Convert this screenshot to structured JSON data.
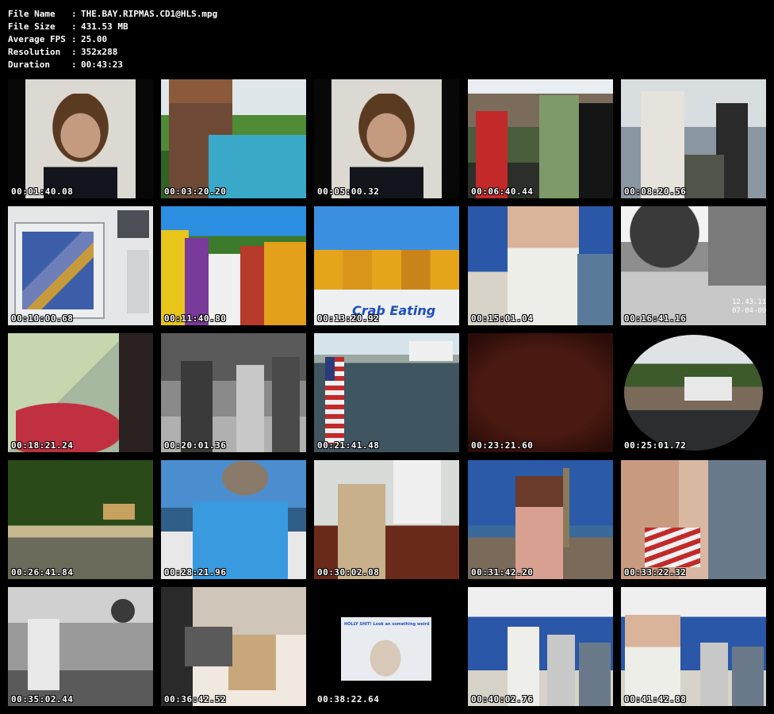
{
  "info": {
    "rows": [
      {
        "key": "File Name",
        "sep": ":",
        "value": "THE.BAY.RIPMAS.CD1@HLS.mpg"
      },
      {
        "key": "File Size",
        "sep": ":",
        "value": "431.53 MB"
      },
      {
        "key": "Average FPS",
        "sep": ":",
        "value": "25.00"
      },
      {
        "key": "Resolution",
        "sep": ":",
        "value": "352x288"
      },
      {
        "key": "Duration",
        "sep": ":",
        "value": "00:43:23"
      }
    ]
  },
  "thumbnails": [
    {
      "timestamp": "00:01:40.08"
    },
    {
      "timestamp": "00:03:20.20"
    },
    {
      "timestamp": "00:05:00.32"
    },
    {
      "timestamp": "00:06:40.44"
    },
    {
      "timestamp": "00:08:20.56"
    },
    {
      "timestamp": "00:10:00.68"
    },
    {
      "timestamp": "00:11:40.80"
    },
    {
      "timestamp": "00:13:20.92",
      "caption": "Crab Eating"
    },
    {
      "timestamp": "00:15:01.04"
    },
    {
      "timestamp": "00:16:41.16",
      "caption": "12.43.11\n07-04-09"
    },
    {
      "timestamp": "00:18:21.24"
    },
    {
      "timestamp": "00:20:01.36"
    },
    {
      "timestamp": "00:21:41.48"
    },
    {
      "timestamp": "00:23:21.60"
    },
    {
      "timestamp": "00:25:01.72"
    },
    {
      "timestamp": "00:26:41.84"
    },
    {
      "timestamp": "00:28:21.96"
    },
    {
      "timestamp": "00:30:02.08"
    },
    {
      "timestamp": "00:31:42.20"
    },
    {
      "timestamp": "00:33:22.32"
    },
    {
      "timestamp": "00:35:02.44"
    },
    {
      "timestamp": "00:36:42.52"
    },
    {
      "timestamp": "00:38:22.64",
      "caption": "HOLLY SHIT! Look an something weird"
    },
    {
      "timestamp": "00:40:02.76"
    },
    {
      "timestamp": "00:41:42.88"
    }
  ],
  "colors": {
    "background": "#000000",
    "text": "#ffffff"
  }
}
